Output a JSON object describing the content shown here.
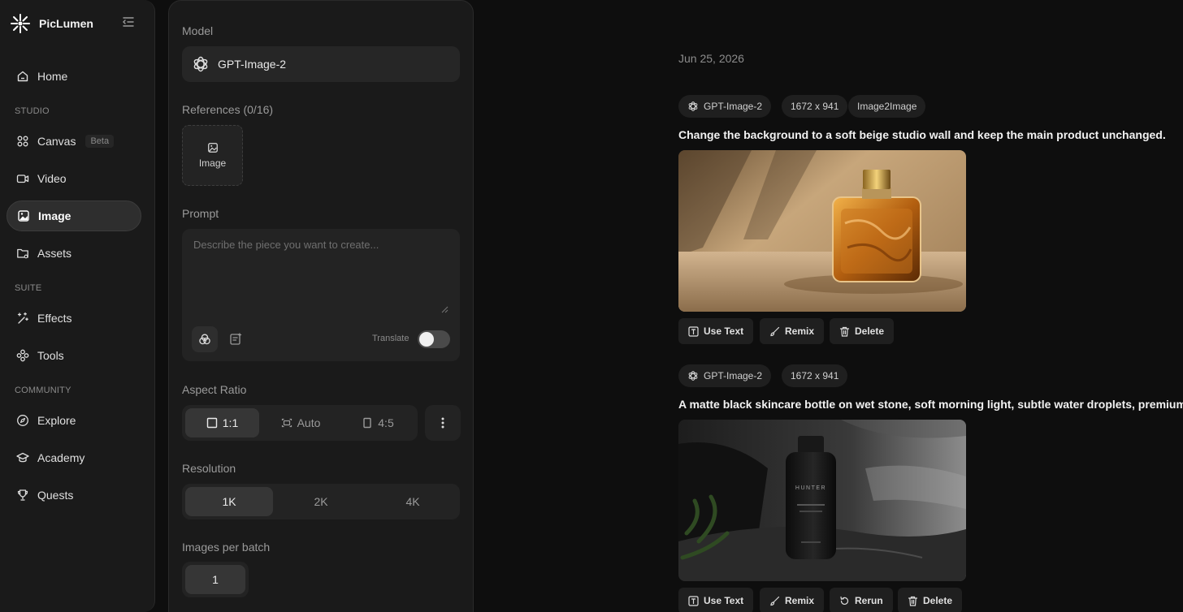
{
  "brand": {
    "name": "PicLumen"
  },
  "sidebar": {
    "home": "Home",
    "studio_label": "STUDIO",
    "canvas": "Canvas",
    "canvas_badge": "Beta",
    "video": "Video",
    "image": "Image",
    "assets": "Assets",
    "suite_label": "SUITE",
    "effects": "Effects",
    "tools": "Tools",
    "community_label": "COMMUNITY",
    "explore": "Explore",
    "academy": "Academy",
    "quests": "Quests"
  },
  "panel": {
    "model_label": "Model",
    "model_value": "GPT-Image-2",
    "references_label": "References (0/16)",
    "reference_button": "Image",
    "prompt_label": "Prompt",
    "prompt_placeholder": "Describe the piece you want to create...",
    "translate_label": "Translate",
    "translate_on": false,
    "aspect_label": "Aspect Ratio",
    "aspect_options": [
      "1:1",
      "Auto",
      "4:5"
    ],
    "aspect_selected": "1:1",
    "resolution_label": "Resolution",
    "resolution_options": [
      "1K",
      "2K",
      "4K"
    ],
    "resolution_selected": "1K",
    "batch_label": "Images per batch",
    "batch_value": "1"
  },
  "feed": {
    "date": "Jun 25, 2026",
    "entries": [
      {
        "tags": [
          "GPT-Image-2",
          "1672 x 941",
          "Image2Image"
        ],
        "prompt": "Change the background to a soft beige studio wall and keep the main product unchanged.",
        "actions": [
          "Use Text",
          "Remix",
          "Delete"
        ]
      },
      {
        "tags": [
          "GPT-Image-2",
          "1672 x 941"
        ],
        "prompt": "A matte black skincare bottle on wet stone, soft morning light, subtle water droplets, premium",
        "bottle_label": "HUNTER",
        "actions": [
          "Use Text",
          "Remix",
          "Rerun",
          "Delete"
        ]
      }
    ]
  }
}
